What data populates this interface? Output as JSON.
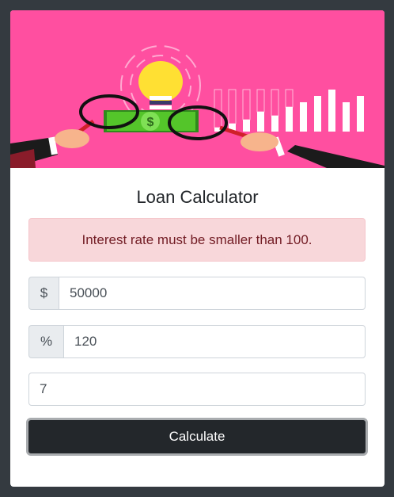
{
  "card": {
    "title": "Loan Calculator",
    "alert_message": "Interest rate must be smaller than 100.",
    "amount": {
      "addon": "$",
      "value": "50000"
    },
    "interest": {
      "addon": "%",
      "value": "120"
    },
    "years": {
      "value": "7"
    },
    "calculate_label": "Calculate"
  },
  "hero": {
    "money_symbol": "$",
    "colors": {
      "background": "#ff4fa0",
      "money": "#54c52a",
      "bulb": "#ffe033",
      "sleeve": "#1b1b1b"
    }
  }
}
